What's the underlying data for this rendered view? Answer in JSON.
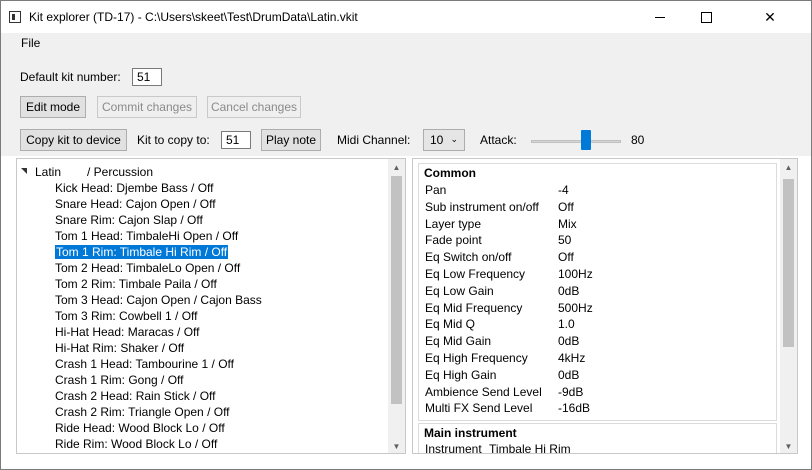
{
  "window": {
    "title": "Kit explorer (TD-17) - C:\\Users\\skeet\\Test\\DrumData\\Latin.vkit"
  },
  "menu": {
    "file": "File"
  },
  "toolbar": {
    "default_kit_label": "Default kit number:",
    "default_kit_value": "51",
    "edit_mode": "Edit mode",
    "commit_changes": "Commit changes",
    "cancel_changes": "Cancel changes",
    "copy_kit": "Copy kit to device",
    "kit_to_copy_label": "Kit to copy to:",
    "kit_to_copy_value": "51",
    "play_note": "Play note",
    "midi_channel_label": "Midi Channel:",
    "midi_channel_value": "10",
    "attack_label": "Attack:",
    "attack_value": "80",
    "attack_level": 0.63
  },
  "tree": {
    "root_name": "Latin",
    "root_category": "/ Percussion",
    "items": [
      "Kick Head: Djembe Bass / Off",
      "Snare Head: Cajon Open / Off",
      "Snare Rim: Cajon Slap / Off",
      "Tom 1 Head: TimbaleHi Open / Off",
      "Tom 1 Rim: Timbale Hi Rim / Off",
      "Tom 2 Head: TimbaleLo Open / Off",
      "Tom 2 Rim: Timbale Paila / Off",
      "Tom 3 Head: Cajon Open / Cajon Bass",
      "Tom 3 Rim: Cowbell 1 / Off",
      "Hi-Hat Head: Maracas / Off",
      "Hi-Hat Rim: Shaker / Off",
      "Crash 1 Head: Tambourine 1 / Off",
      "Crash 1 Rim: Gong / Off",
      "Crash 2 Head: Rain Stick / Off",
      "Crash 2 Rim: Triangle Open / Off",
      "Ride Head: Wood Block Lo / Off",
      "Ride Rim: Wood Block Lo / Off"
    ],
    "selected_index": 4
  },
  "common": {
    "title": "Common",
    "rows": [
      {
        "label": "Pan",
        "value": "-4"
      },
      {
        "label": "Sub instrument on/off",
        "value": "Off"
      },
      {
        "label": "Layer type",
        "value": "Mix"
      },
      {
        "label": "Fade point",
        "value": "50"
      },
      {
        "label": "Eq Switch on/off",
        "value": "Off"
      },
      {
        "label": "Eq Low Frequency",
        "value": "100Hz"
      },
      {
        "label": "Eq Low Gain",
        "value": "0dB"
      },
      {
        "label": "Eq Mid Frequency",
        "value": "500Hz"
      },
      {
        "label": "Eq Mid Q",
        "value": "1.0"
      },
      {
        "label": "Eq Mid Gain",
        "value": "0dB"
      },
      {
        "label": "Eq High Frequency",
        "value": "4kHz"
      },
      {
        "label": "Eq High Gain",
        "value": "0dB"
      },
      {
        "label": "Ambience Send Level",
        "value": "-9dB"
      },
      {
        "label": "Multi FX Send Level",
        "value": "-16dB"
      }
    ]
  },
  "main_instrument": {
    "title": "Main instrument",
    "instrument_label": "Instrument",
    "instrument_value": "Timbale Hi Rim"
  },
  "colors": {
    "selection": "#0078d7",
    "slider_thumb": "#007ad9",
    "toolbar_bg": "#f0f0f0"
  }
}
